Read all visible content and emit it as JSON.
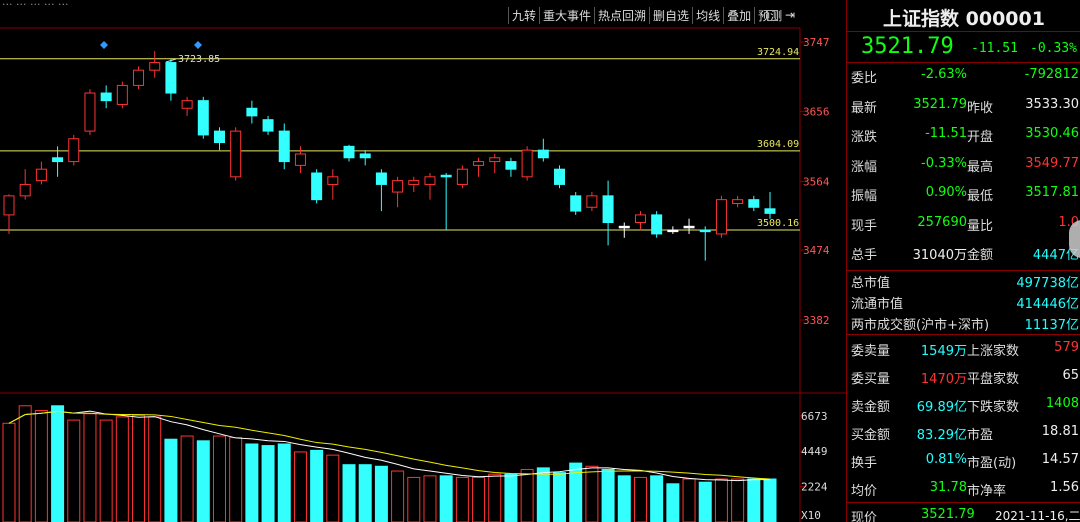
{
  "header": {
    "top_left_partial": "··· ··· ··· ··· ···",
    "toolbar": [
      "九转",
      "重大事件",
      "热点回溯",
      "删自选",
      "均线",
      "叠加",
      "预测"
    ]
  },
  "kline": {
    "y_ticks": [
      "3747",
      "3656",
      "3564",
      "3474",
      "3382"
    ],
    "hlines": [
      "3724.94",
      "3604.09",
      "3500.16"
    ],
    "annotation_high": "3723.85",
    "candles": [
      [
        3520,
        3545,
        3495,
        3547,
        "r"
      ],
      [
        3545,
        3560,
        3540,
        3580,
        "r"
      ],
      [
        3565,
        3580,
        3560,
        3590,
        "r"
      ],
      [
        3595,
        3590,
        3570,
        3610,
        "c"
      ],
      [
        3590,
        3620,
        3585,
        3625,
        "r"
      ],
      [
        3630,
        3680,
        3625,
        3685,
        "r"
      ],
      [
        3670,
        3680,
        3660,
        3690,
        "c"
      ],
      [
        3665,
        3690,
        3660,
        3695,
        "r"
      ],
      [
        3690,
        3710,
        3685,
        3715,
        "r"
      ],
      [
        3710,
        3720,
        3700,
        3735,
        "r"
      ],
      [
        3720,
        3680,
        3670,
        3725,
        "c"
      ],
      [
        3670,
        3660,
        3650,
        3675,
        "r"
      ],
      [
        3670,
        3625,
        3620,
        3675,
        "c"
      ],
      [
        3630,
        3615,
        3605,
        3635,
        "c"
      ],
      [
        3630,
        3570,
        3565,
        3635,
        "r"
      ],
      [
        3660,
        3650,
        3640,
        3670,
        "c"
      ],
      [
        3645,
        3630,
        3625,
        3650,
        "c"
      ],
      [
        3630,
        3590,
        3580,
        3640,
        "c"
      ],
      [
        3585,
        3600,
        3575,
        3610,
        "r"
      ],
      [
        3575,
        3540,
        3535,
        3580,
        "c"
      ],
      [
        3560,
        3570,
        3540,
        3580,
        "r"
      ],
      [
        3610,
        3595,
        3590,
        3612,
        "c"
      ],
      [
        3600,
        3595,
        3585,
        3605,
        "c"
      ],
      [
        3575,
        3560,
        3525,
        3580,
        "c"
      ],
      [
        3550,
        3565,
        3530,
        3570,
        "r"
      ],
      [
        3560,
        3565,
        3550,
        3570,
        "r"
      ],
      [
        3560,
        3570,
        3540,
        3575,
        "r"
      ],
      [
        3572,
        3570,
        3500,
        3575,
        "c"
      ],
      [
        3560,
        3580,
        3555,
        3585,
        "r"
      ],
      [
        3585,
        3590,
        3570,
        3595,
        "r"
      ],
      [
        3595,
        3590,
        3575,
        3600,
        "r"
      ],
      [
        3590,
        3580,
        3570,
        3595,
        "c"
      ],
      [
        3570,
        3605,
        3565,
        3610,
        "r"
      ],
      [
        3605,
        3595,
        3590,
        3620,
        "c"
      ],
      [
        3580,
        3560,
        3555,
        3585,
        "c"
      ],
      [
        3545,
        3525,
        3520,
        3550,
        "c"
      ],
      [
        3530,
        3545,
        3525,
        3550,
        "r"
      ],
      [
        3545,
        3510,
        3480,
        3565,
        "c"
      ],
      [
        3505,
        3505,
        3490,
        3510,
        "w"
      ],
      [
        3510,
        3520,
        3500,
        3525,
        "r"
      ],
      [
        3520,
        3495,
        3490,
        3525,
        "c"
      ],
      [
        3500,
        3500,
        3495,
        3505,
        "w"
      ],
      [
        3505,
        3505,
        3495,
        3515,
        "w"
      ],
      [
        3498,
        3500,
        3460,
        3505,
        "c"
      ],
      [
        3495,
        3540,
        3490,
        3545,
        "r"
      ],
      [
        3535,
        3540,
        3530,
        3545,
        "r"
      ],
      [
        3540,
        3530,
        3525,
        3545,
        "c"
      ],
      [
        3528,
        3522,
        3515,
        3550,
        "c"
      ]
    ]
  },
  "volume": {
    "y_ticks": [
      "6673",
      "4449",
      "2224"
    ],
    "axis_unit": "X10",
    "bars": [
      [
        6200,
        "r"
      ],
      [
        7300,
        "r"
      ],
      [
        7000,
        "r"
      ],
      [
        7300,
        "c"
      ],
      [
        6400,
        "r"
      ],
      [
        6800,
        "r"
      ],
      [
        6400,
        "r"
      ],
      [
        6600,
        "r"
      ],
      [
        6700,
        "r"
      ],
      [
        6600,
        "r"
      ],
      [
        5200,
        "c"
      ],
      [
        5400,
        "r"
      ],
      [
        5100,
        "c"
      ],
      [
        5400,
        "r"
      ],
      [
        5300,
        "r"
      ],
      [
        4900,
        "c"
      ],
      [
        4800,
        "c"
      ],
      [
        4900,
        "c"
      ],
      [
        4400,
        "r"
      ],
      [
        4500,
        "c"
      ],
      [
        4200,
        "r"
      ],
      [
        3600,
        "c"
      ],
      [
        3600,
        "c"
      ],
      [
        3500,
        "c"
      ],
      [
        3200,
        "r"
      ],
      [
        2800,
        "r"
      ],
      [
        2900,
        "r"
      ],
      [
        2900,
        "c"
      ],
      [
        2800,
        "r"
      ],
      [
        2800,
        "r"
      ],
      [
        3000,
        "r"
      ],
      [
        3000,
        "c"
      ],
      [
        3300,
        "r"
      ],
      [
        3400,
        "c"
      ],
      [
        3100,
        "c"
      ],
      [
        3700,
        "c"
      ],
      [
        3500,
        "r"
      ],
      [
        3300,
        "c"
      ],
      [
        2900,
        "c"
      ],
      [
        2800,
        "r"
      ],
      [
        2900,
        "c"
      ],
      [
        2400,
        "c"
      ],
      [
        2700,
        "r"
      ],
      [
        2500,
        "c"
      ],
      [
        2700,
        "r"
      ],
      [
        2700,
        "r"
      ],
      [
        2700,
        "c"
      ],
      [
        2700,
        "c"
      ]
    ]
  },
  "panel": {
    "title": "上证指数 000001",
    "price": "3521.79",
    "change": "-11.51",
    "change_pct": "-0.33%",
    "rows": [
      {
        "l1": "委比",
        "v1": "-2.63%",
        "c1": "g",
        "l2": "",
        "v2": "-792812",
        "c2": "g"
      },
      {
        "l1": "最新",
        "v1": "3521.79",
        "c1": "g",
        "l2": "昨收",
        "v2": "3533.30",
        "c2": "w"
      },
      {
        "l1": "涨跌",
        "v1": "-11.51",
        "c1": "g",
        "l2": "开盘",
        "v2": "3530.46",
        "c2": "g"
      },
      {
        "l1": "涨幅",
        "v1": "-0.33%",
        "c1": "g",
        "l2": "最高",
        "v2": "3549.77",
        "c2": "r"
      },
      {
        "l1": "振幅",
        "v1": "0.90%",
        "c1": "g",
        "l2": "最低",
        "v2": "3517.81",
        "c2": "g"
      },
      {
        "l1": "现手",
        "v1": "257690",
        "c1": "g",
        "l2": "量比",
        "v2": "1.0",
        "c2": "r"
      },
      {
        "l1": "总手",
        "v1": "31040万",
        "c1": "w",
        "l2": "金额",
        "v2": "4447亿",
        "c2": "c"
      }
    ],
    "stats": [
      {
        "l": "总市值",
        "v": "497738亿"
      },
      {
        "l": "流通市值",
        "v": "414446亿"
      },
      {
        "l": "两市成交额(沪市+深市)",
        "v": "11137亿"
      }
    ],
    "rows2": [
      {
        "l1": "委卖量",
        "v1": "1549万",
        "c1": "c",
        "l2": "上涨家数",
        "v2": "579",
        "c2": "r"
      },
      {
        "l1": "委买量",
        "v1": "1470万",
        "c1": "r",
        "l2": "平盘家数",
        "v2": "65",
        "c2": "w"
      },
      {
        "l1": "卖金额",
        "v1": "69.89亿",
        "c1": "c",
        "l2": "下跌家数",
        "v2": "1408",
        "c2": "g"
      },
      {
        "l1": "买金额",
        "v1": "83.29亿",
        "c1": "c",
        "l2": "市盈",
        "v2": "18.81",
        "c2": "w"
      },
      {
        "l1": "换手",
        "v1": "0.81%",
        "c1": "c",
        "l2": "市盈(动)",
        "v2": "14.57",
        "c2": "w"
      },
      {
        "l1": "均价",
        "v1": "31.78",
        "c1": "g",
        "l2": "市净率",
        "v2": "1.56",
        "c2": "w"
      }
    ],
    "footer": {
      "label": "现价",
      "value": "3521.79",
      "date": "2021-11-16,二"
    }
  },
  "colors": {
    "up": "#ff3333",
    "down": "#33ffff",
    "flat": "#ffffff",
    "hline": "#e8e860",
    "grid": "#880000"
  }
}
